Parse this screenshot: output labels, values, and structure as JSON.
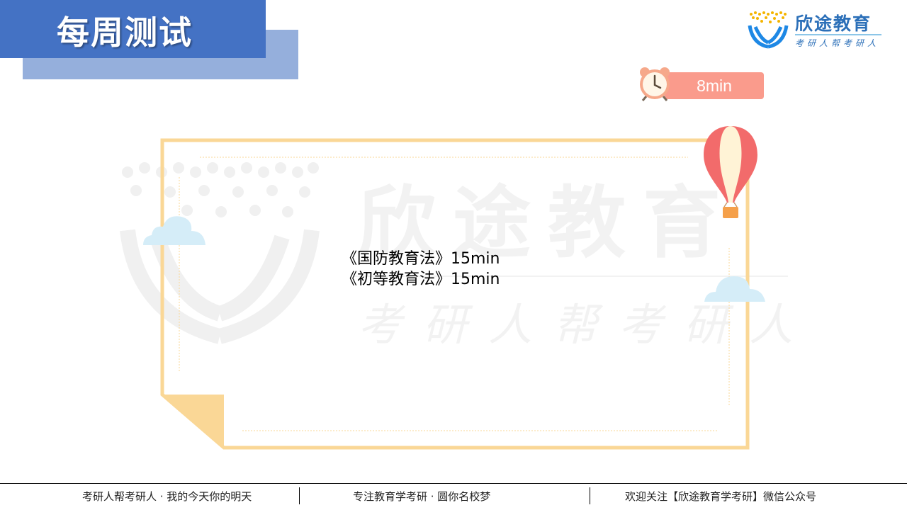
{
  "header": {
    "title": "每周测试"
  },
  "logo": {
    "name": "欣途教育",
    "slogan": "考研人帮考研人"
  },
  "timer": {
    "label": "8min",
    "icon": "alarm-clock-icon"
  },
  "watermark": {
    "name": "欣途教育",
    "slogan": "考研人帮考研人"
  },
  "content": {
    "items": [
      "《国防教育法》15min",
      "《初等教育法》15min"
    ]
  },
  "footer": {
    "left": "考研人帮考研人 · 我的今天你的明天",
    "center": "专注教育学考研 · 圆你名校梦",
    "right": "欢迎关注【欣途教育学考研】微信公众号"
  },
  "colors": {
    "title_bar": "#4472c4",
    "title_shadow": "#95afdc",
    "timer": "#fa9b8c",
    "frame": "#fad796",
    "brand": "#2b6fb8"
  }
}
